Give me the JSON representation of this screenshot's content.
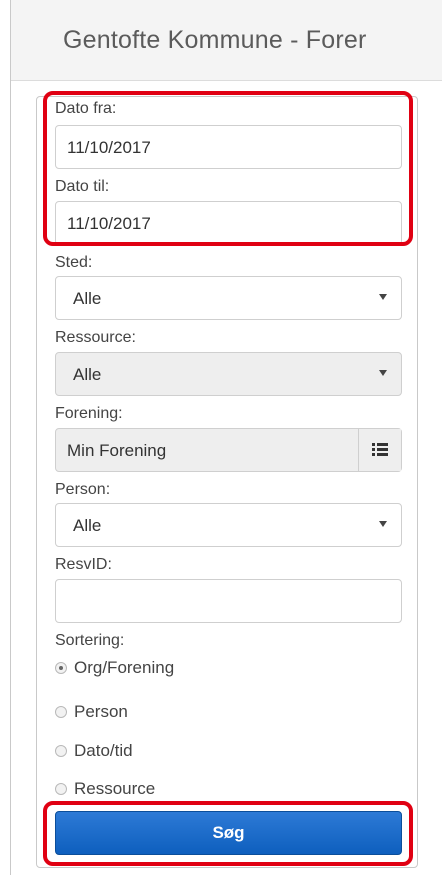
{
  "header": {
    "title": "Gentofte Kommune - Forer"
  },
  "form": {
    "date_from_label": "Dato fra:",
    "date_from_value": "11/10/2017",
    "date_to_label": "Dato til:",
    "date_to_value": "11/10/2017",
    "sted_label": "Sted:",
    "sted_value": "Alle",
    "ressource_label": "Ressource:",
    "ressource_value": "Alle",
    "forening_label": "Forening:",
    "forening_value": "Min Forening",
    "person_label": "Person:",
    "person_value": "Alle",
    "resvid_label": "ResvID:",
    "resvid_value": "",
    "sortering_label": "Sortering:",
    "sort_options": [
      "Org/Forening",
      "Person",
      "Dato/tid",
      "Ressource"
    ],
    "sort_selected": "Org/Forening",
    "search_button": "Søg"
  },
  "icons": {
    "forening_picker": "list-icon",
    "dropdown": "caret-down-icon"
  },
  "colors": {
    "highlight": "#e00012",
    "button": "#1a6bcc"
  }
}
